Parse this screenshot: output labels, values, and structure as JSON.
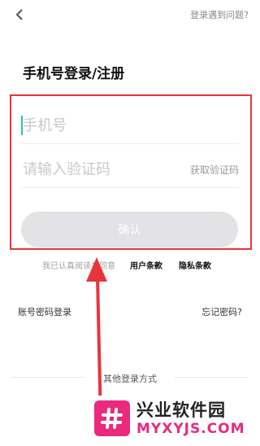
{
  "header": {
    "back_icon": "chevron-left-icon",
    "help_link": "登录遇到问题?"
  },
  "title": "手机号登录/注册",
  "form": {
    "phone_placeholder": "手机号",
    "code_placeholder": "请输入验证码",
    "get_code": "获取验证码",
    "confirm": "确认"
  },
  "agreement": {
    "text": "我已认真阅读并同意",
    "user_terms": "用户条款",
    "privacy_terms": "隐私条款"
  },
  "options": {
    "password_login": "账号密码登录",
    "forgot_password": "忘记密码?"
  },
  "other_login": "其他登录方式",
  "watermark": {
    "name": "兴业软件园",
    "url": "MYXYJS.COM",
    "accent": "#e92a7d"
  },
  "annotation": {
    "color": "#e8343b"
  }
}
